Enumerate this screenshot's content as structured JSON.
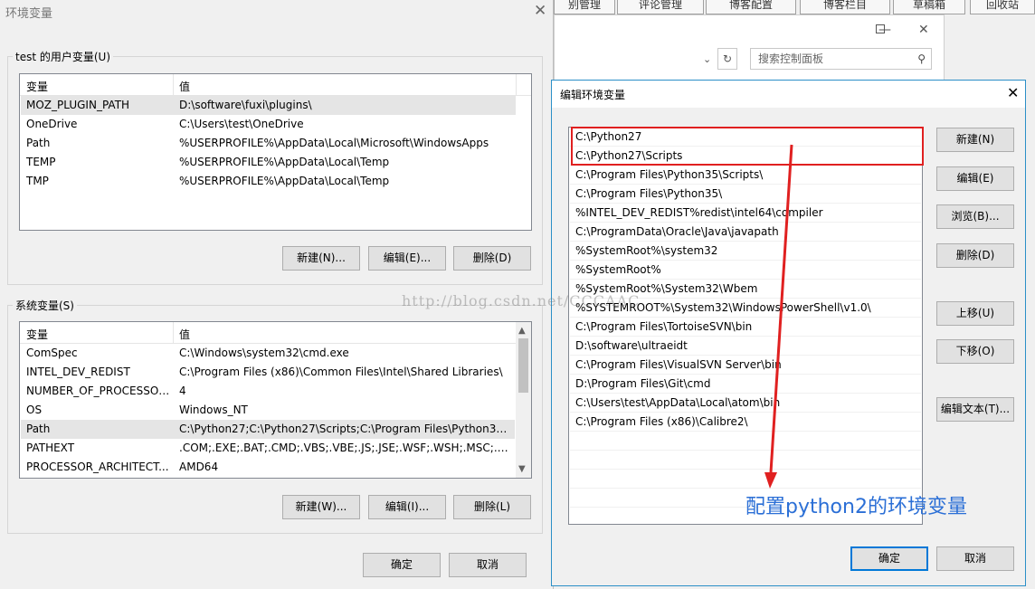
{
  "background": {
    "tabs": [
      "别管理",
      "评论管理",
      "博客配置",
      "博客栏目",
      "草稿箱",
      "回收站"
    ],
    "search_placeholder": "搜索控制面板"
  },
  "env_dialog": {
    "title": "环境变量",
    "user_group_label": "test 的用户变量(U)",
    "col_var": "变量",
    "col_val": "值",
    "user_vars": [
      {
        "name": "MOZ_PLUGIN_PATH",
        "value": "D:\\software\\fuxi\\plugins\\"
      },
      {
        "name": "OneDrive",
        "value": "C:\\Users\\test\\OneDrive"
      },
      {
        "name": "Path",
        "value": "%USERPROFILE%\\AppData\\Local\\Microsoft\\WindowsApps"
      },
      {
        "name": "TEMP",
        "value": "%USERPROFILE%\\AppData\\Local\\Temp"
      },
      {
        "name": "TMP",
        "value": "%USERPROFILE%\\AppData\\Local\\Temp"
      }
    ],
    "user_new": "新建(N)...",
    "user_edit": "编辑(E)...",
    "user_delete": "删除(D)",
    "sys_group_label": "系统变量(S)",
    "sys_vars": [
      {
        "name": "ComSpec",
        "value": "C:\\Windows\\system32\\cmd.exe"
      },
      {
        "name": "INTEL_DEV_REDIST",
        "value": "C:\\Program Files (x86)\\Common Files\\Intel\\Shared Libraries\\"
      },
      {
        "name": "NUMBER_OF_PROCESSORS",
        "value": "4"
      },
      {
        "name": "OS",
        "value": "Windows_NT"
      },
      {
        "name": "Path",
        "value": "C:\\Python27;C:\\Python27\\Scripts;C:\\Program Files\\Python35\\S..."
      },
      {
        "name": "PATHEXT",
        "value": ".COM;.EXE;.BAT;.CMD;.VBS;.VBE;.JS;.JSE;.WSF;.WSH;.MSC;.PY;.P..."
      },
      {
        "name": "PROCESSOR_ARCHITECT...",
        "value": "AMD64"
      }
    ],
    "sys_new": "新建(W)...",
    "sys_edit": "编辑(I)...",
    "sys_delete": "删除(L)",
    "ok": "确定",
    "cancel": "取消"
  },
  "edit_dialog": {
    "title": "编辑环境变量",
    "paths": [
      "C:\\Python27",
      "C:\\Python27\\Scripts",
      "C:\\Program Files\\Python35\\Scripts\\",
      "C:\\Program Files\\Python35\\",
      "%INTEL_DEV_REDIST%redist\\intel64\\compiler",
      "C:\\ProgramData\\Oracle\\Java\\javapath",
      "%SystemRoot%\\system32",
      "%SystemRoot%",
      "%SystemRoot%\\System32\\Wbem",
      "%SYSTEMROOT%\\System32\\WindowsPowerShell\\v1.0\\",
      "C:\\Program Files\\TortoiseSVN\\bin",
      "D:\\software\\ultraeidt",
      "C:\\Program Files\\VisualSVN Server\\bin",
      "D:\\Program Files\\Git\\cmd",
      "C:\\Users\\test\\AppData\\Local\\atom\\bin",
      "C:\\Program Files (x86)\\Calibre2\\"
    ],
    "btn_new": "新建(N)",
    "btn_edit": "编辑(E)",
    "btn_browse": "浏览(B)...",
    "btn_delete": "删除(D)",
    "btn_up": "上移(U)",
    "btn_down": "下移(O)",
    "btn_edit_text": "编辑文本(T)...",
    "ok": "确定",
    "cancel": "取消"
  },
  "annotation": "配置python2的环境变量",
  "watermark": "http://blog.csdn.net/CCCAAC"
}
